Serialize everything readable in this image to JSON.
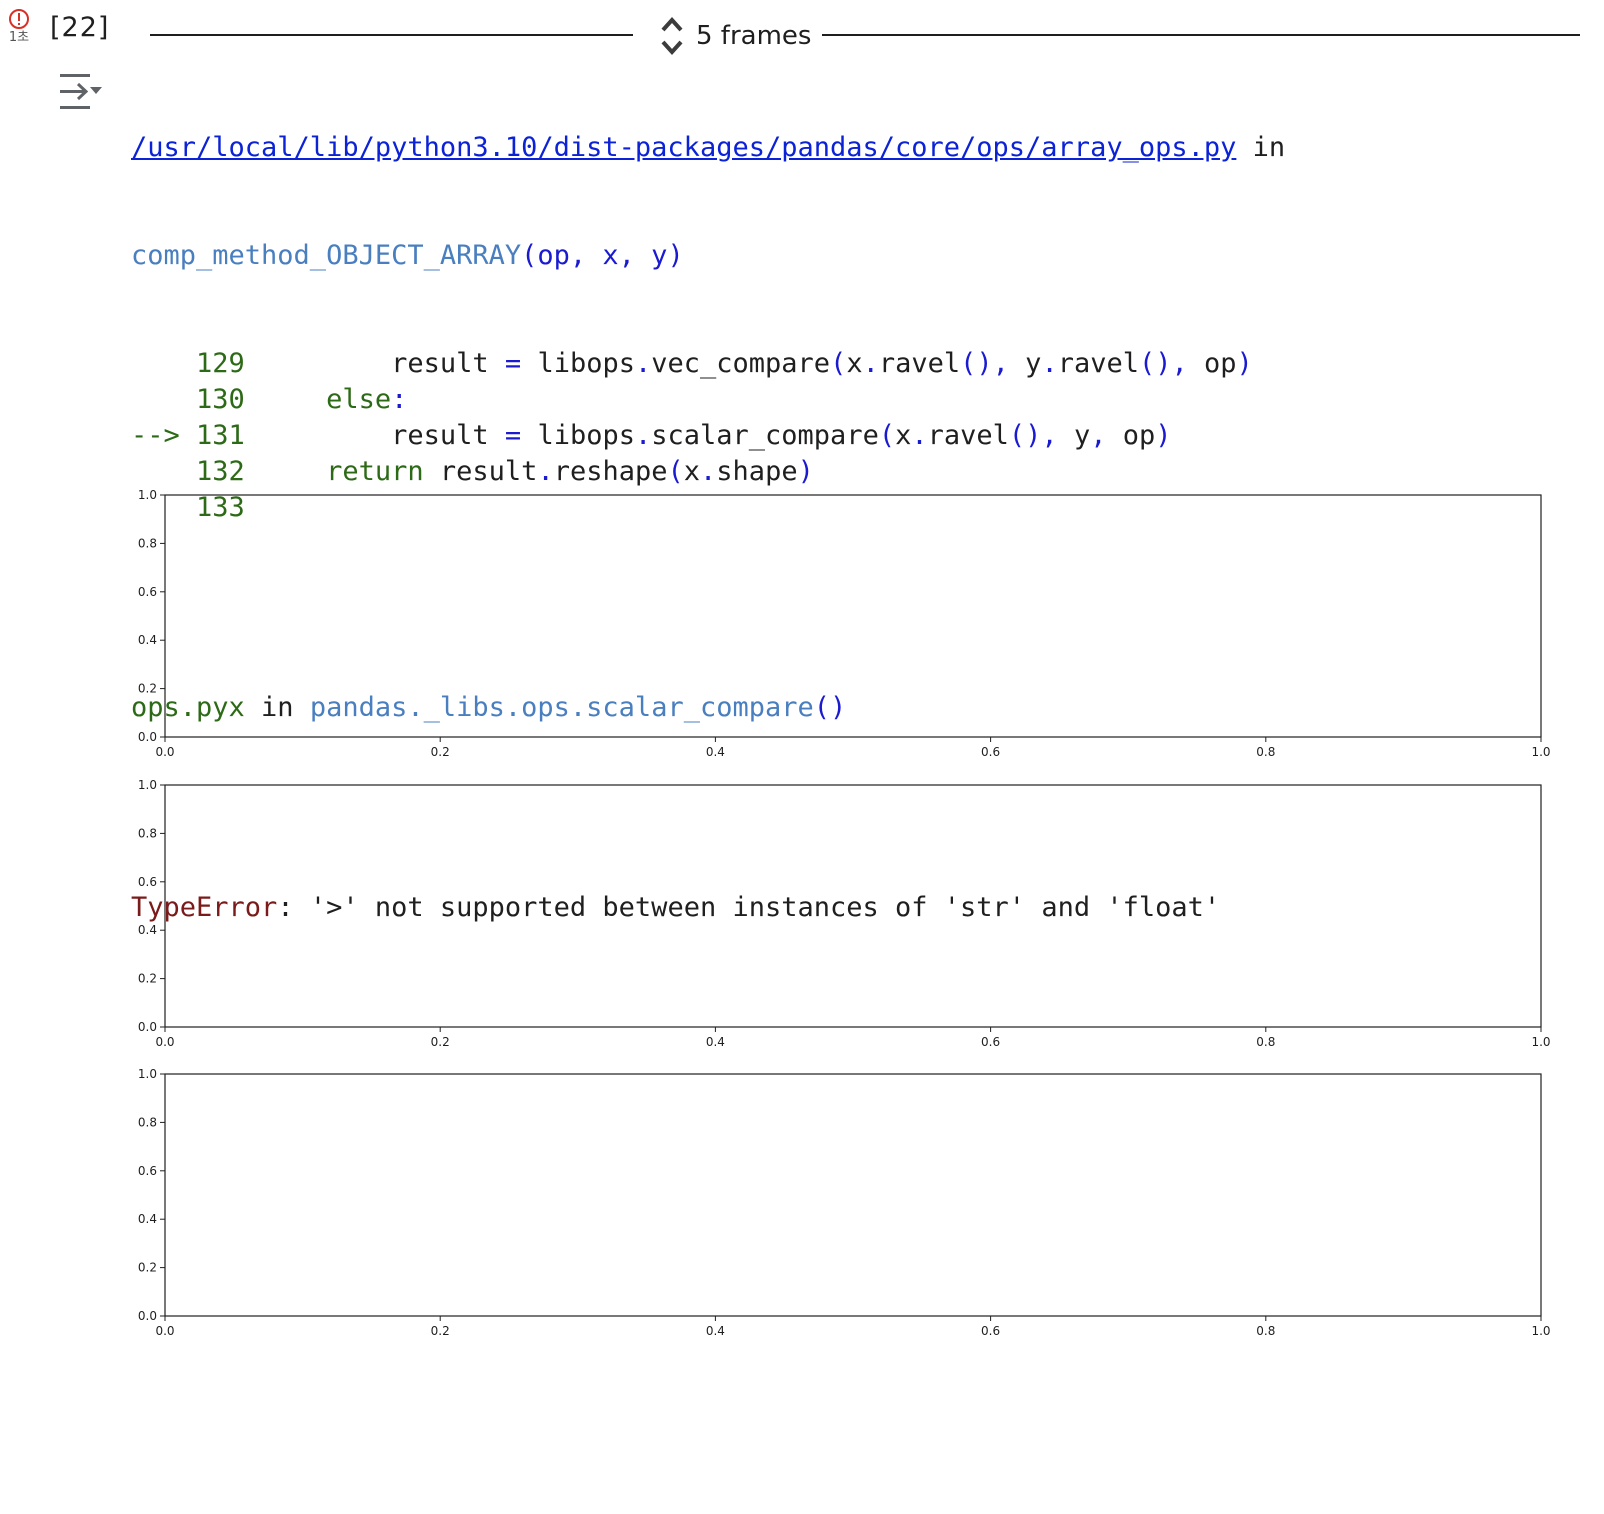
{
  "cell": {
    "status_icon": "error-circle-icon",
    "status_color": "#d93025",
    "duration": "1초",
    "execution_count": "[22]",
    "output_toggle_icon": "collapse-output-icon"
  },
  "frames": {
    "label": "5 frames",
    "icon": "expand-collapse-arrows-icon"
  },
  "traceback": {
    "file_path": "/usr/local/lib/python3.10/dist-packages/pandas/core/ops/array_ops.py",
    "in_word": " in",
    "function_name": "comp_method_OBJECT_ARRAY",
    "function_args": "(op, x, y)",
    "lines": [
      {
        "prefix": "    ",
        "number": "129",
        "code_indent": "         ",
        "parts": [
          {
            "t": "result ",
            "c": "plain"
          },
          {
            "t": "=",
            "c": "op"
          },
          {
            "t": " libops",
            "c": "plain"
          },
          {
            "t": ".",
            "c": "op"
          },
          {
            "t": "vec_compare",
            "c": "plain"
          },
          {
            "t": "(",
            "c": "op"
          },
          {
            "t": "x",
            "c": "plain"
          },
          {
            "t": ".",
            "c": "op"
          },
          {
            "t": "ravel",
            "c": "plain"
          },
          {
            "t": "(),",
            "c": "op"
          },
          {
            "t": " y",
            "c": "plain"
          },
          {
            "t": ".",
            "c": "op"
          },
          {
            "t": "ravel",
            "c": "plain"
          },
          {
            "t": "(),",
            "c": "op"
          },
          {
            "t": " op",
            "c": "plain"
          },
          {
            "t": ")",
            "c": "op"
          }
        ]
      },
      {
        "prefix": "    ",
        "number": "130",
        "code_indent": "     ",
        "parts": [
          {
            "t": "else",
            "c": "kw"
          },
          {
            "t": ":",
            "c": "op"
          }
        ]
      },
      {
        "prefix": "--> ",
        "number": "131",
        "code_indent": "         ",
        "parts": [
          {
            "t": "result ",
            "c": "plain"
          },
          {
            "t": "=",
            "c": "op"
          },
          {
            "t": " libops",
            "c": "plain"
          },
          {
            "t": ".",
            "c": "op"
          },
          {
            "t": "scalar_compare",
            "c": "plain"
          },
          {
            "t": "(",
            "c": "op"
          },
          {
            "t": "x",
            "c": "plain"
          },
          {
            "t": ".",
            "c": "op"
          },
          {
            "t": "ravel",
            "c": "plain"
          },
          {
            "t": "(),",
            "c": "op"
          },
          {
            "t": " y",
            "c": "plain"
          },
          {
            "t": ",",
            "c": "op"
          },
          {
            "t": " op",
            "c": "plain"
          },
          {
            "t": ")",
            "c": "op"
          }
        ]
      },
      {
        "prefix": "    ",
        "number": "132",
        "code_indent": "     ",
        "parts": [
          {
            "t": "return",
            "c": "kw"
          },
          {
            "t": " result",
            "c": "plain"
          },
          {
            "t": ".",
            "c": "op"
          },
          {
            "t": "reshape",
            "c": "plain"
          },
          {
            "t": "(",
            "c": "op"
          },
          {
            "t": "x",
            "c": "plain"
          },
          {
            "t": ".",
            "c": "op"
          },
          {
            "t": "shape",
            "c": "plain"
          },
          {
            "t": ")",
            "c": "op"
          }
        ]
      },
      {
        "prefix": "    ",
        "number": "133",
        "code_indent": "",
        "parts": []
      }
    ],
    "second_frame_file": "ops.pyx",
    "second_frame_in": " in ",
    "second_frame_function": "pandas._libs.ops.scalar_compare",
    "second_frame_parens": "()",
    "error_type": "TypeError",
    "error_message": ": '>' not supported between instances of 'str' and 'float'"
  },
  "chart_data": [
    {
      "type": "line",
      "series": [],
      "xlim": [
        0.0,
        1.0
      ],
      "ylim": [
        0.0,
        1.0
      ],
      "xticks": [
        "0.0",
        "0.2",
        "0.4",
        "0.6",
        "0.8",
        "1.0"
      ],
      "yticks": [
        "0.0",
        "0.2",
        "0.4",
        "0.6",
        "0.8",
        "1.0"
      ],
      "grid": false
    },
    {
      "type": "line",
      "series": [],
      "xlim": [
        0.0,
        1.0
      ],
      "ylim": [
        0.0,
        1.0
      ],
      "xticks": [
        "0.0",
        "0.2",
        "0.4",
        "0.6",
        "0.8",
        "1.0"
      ],
      "yticks": [
        "0.0",
        "0.2",
        "0.4",
        "0.6",
        "0.8",
        "1.0"
      ],
      "grid": false
    },
    {
      "type": "line",
      "series": [],
      "xlim": [
        0.0,
        1.0
      ],
      "ylim": [
        0.0,
        1.0
      ],
      "xticks": [
        "0.0",
        "0.2",
        "0.4",
        "0.6",
        "0.8",
        "1.0"
      ],
      "yticks": [
        "0.0",
        "0.2",
        "0.4",
        "0.6",
        "0.8",
        "1.0"
      ],
      "grid": false
    }
  ]
}
